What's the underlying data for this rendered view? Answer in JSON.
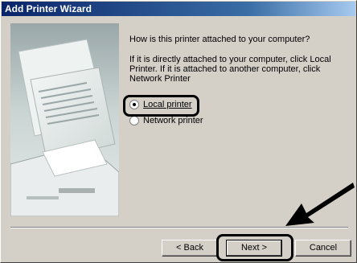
{
  "window": {
    "title": "Add Printer Wizard"
  },
  "page": {
    "question": "How is this printer attached to your computer?",
    "instruction": "If it is directly attached to your computer, click Local Printer. If it is attached to another computer, click Network Printer"
  },
  "options": {
    "local": {
      "label": "Local printer",
      "checked": true
    },
    "network": {
      "label": "Network printer",
      "checked": false
    }
  },
  "buttons": {
    "back": "< Back",
    "next": "Next >",
    "cancel": "Cancel"
  }
}
